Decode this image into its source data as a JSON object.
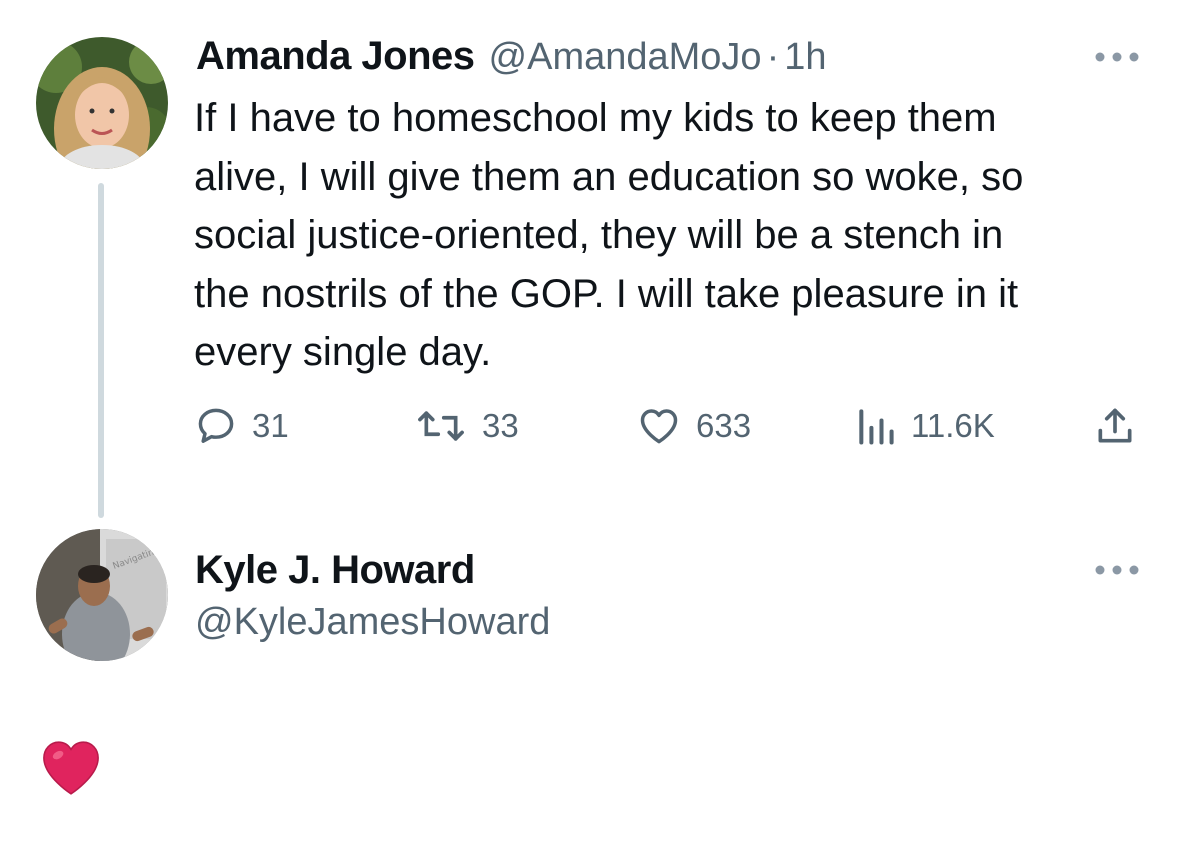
{
  "tweet": {
    "author_name": "Amanda Jones",
    "handle": "@AmandaMoJo",
    "separator": "·",
    "time": "1h",
    "text": "If I have to homeschool my kids to keep them\nalive, I will give them an education so woke, so\nsocial justice-oriented, they will be a stench in\nthe nostrils of the GOP. I will take pleasure in it\nevery    single      day.",
    "replies": "31",
    "retweets": "33",
    "likes": "633",
    "views": "11.6K"
  },
  "reply": {
    "author_name": "Kyle J. Howard",
    "handle": "@KyleJamesHoward",
    "body_emoji": "❤️"
  },
  "icons": {
    "more": "more-horizontal-icon",
    "reply": "reply-bubble-icon",
    "retweet": "retweet-icon",
    "like": "heart-outline-icon",
    "views": "views-bar-chart-icon",
    "share": "share-upload-icon"
  },
  "colors": {
    "text": "#0f1419",
    "secondary": "#536471",
    "thread_line": "#cfd9de",
    "heart": "#e0245e"
  }
}
